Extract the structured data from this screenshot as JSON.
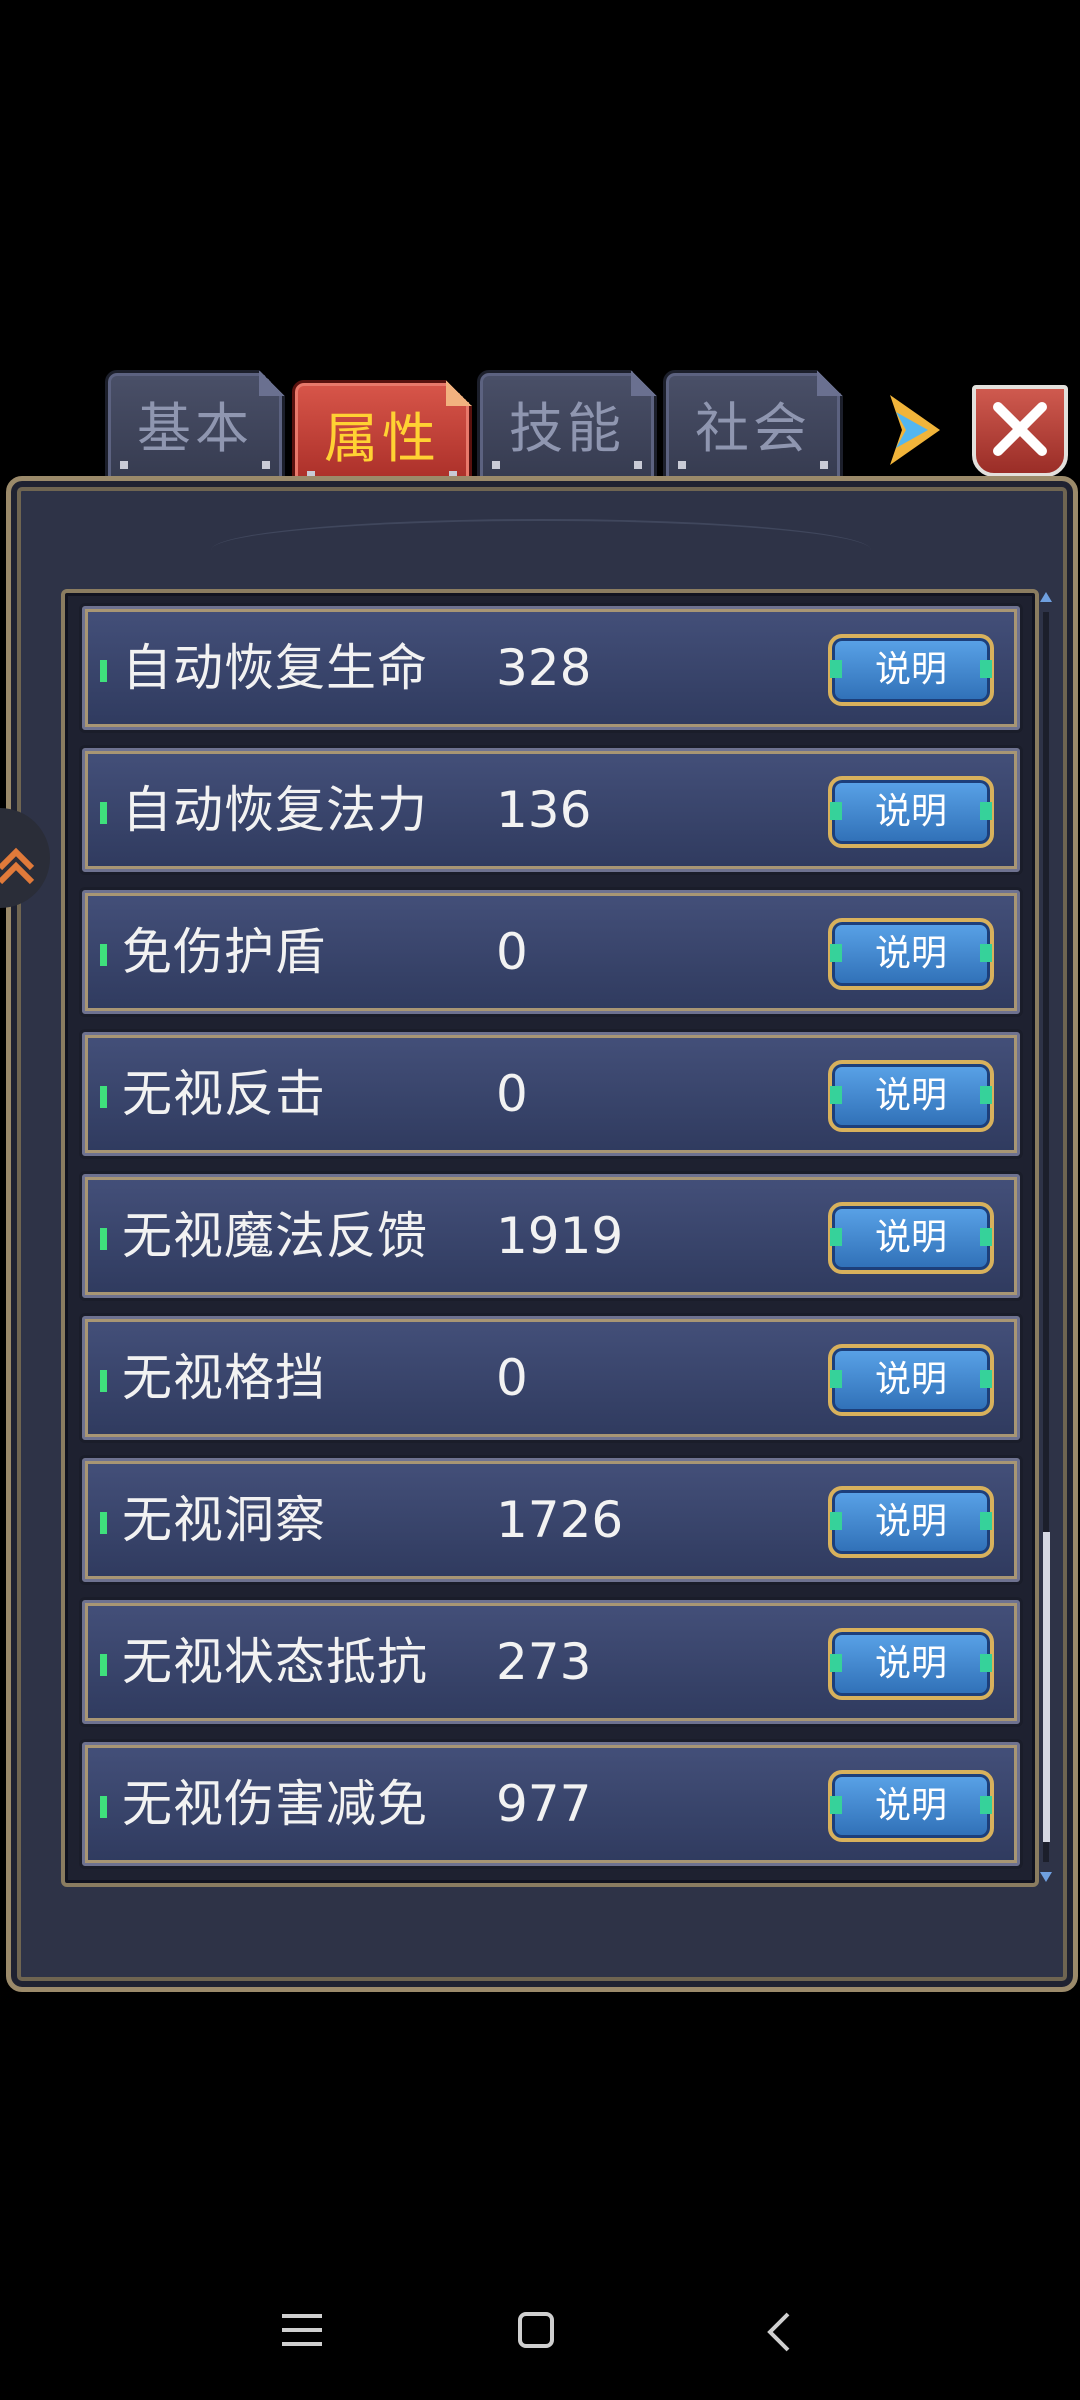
{
  "tabs": [
    {
      "label": "基本",
      "active": false
    },
    {
      "label": "属性",
      "active": true
    },
    {
      "label": "技能",
      "active": false
    },
    {
      "label": "社会",
      "active": false
    }
  ],
  "explain_label": "说明",
  "attributes": [
    {
      "name": "自动恢复生命",
      "value": "328"
    },
    {
      "name": "自动恢复法力",
      "value": "136"
    },
    {
      "name": "免伤护盾",
      "value": "0"
    },
    {
      "name": "无视反击",
      "value": "0"
    },
    {
      "name": "无视魔法反馈",
      "value": "1919"
    },
    {
      "name": "无视格挡",
      "value": "0"
    },
    {
      "name": "无视洞察",
      "value": "1726"
    },
    {
      "name": "无视状态抵抗",
      "value": "273"
    },
    {
      "name": "无视伤害减免",
      "value": "977"
    }
  ],
  "icons": {
    "next": "arrow-right-icon",
    "close": "close-icon",
    "menu": "menu-icon",
    "home": "home-icon",
    "back": "back-icon"
  },
  "colors": {
    "active_tab": "#c0392b",
    "active_tab_text": "#ffd233",
    "button_blue": "#3f86d0",
    "pip_green": "#3fe07c"
  }
}
